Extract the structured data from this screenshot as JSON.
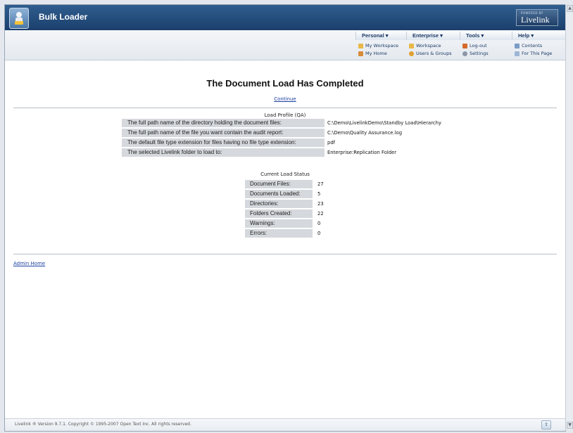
{
  "header": {
    "title": "Bulk Loader",
    "brand_small": "POWERED BY",
    "brand_name": "Livelink"
  },
  "nav": {
    "menus": [
      {
        "label": "Personal ▾",
        "links": [
          "My Workspace",
          "My Home"
        ]
      },
      {
        "label": "Enterprise ▾",
        "links": [
          "Workspace",
          "Users & Groups"
        ]
      },
      {
        "label": "Tools ▾",
        "links": [
          "Log-out",
          "Settings"
        ]
      },
      {
        "label": "Help ▾",
        "links": [
          "Contents",
          "For This Page"
        ]
      }
    ]
  },
  "page": {
    "title": "The Document Load Has Completed",
    "continue_link": "Continue",
    "profile_heading": "Load Profile (QA)",
    "profile_rows": [
      {
        "label": "The full path name of the directory holding the document files:",
        "value": "C:\\Demo\\LivelinkDemo\\Standby Load\\Hierarchy"
      },
      {
        "label": "The full path name of the file you want contain the audit report:",
        "value": "C:\\Demo\\Quality Assurance.log"
      },
      {
        "label": "The default file type extension for files having no file type extension:",
        "value": "pdf"
      },
      {
        "label": "The selected Livelink folder to load to:",
        "value": "Enterprise:Replication Folder"
      }
    ],
    "status_heading": "Current Load Status",
    "status_rows": [
      {
        "label": "Document Files:",
        "value": "27"
      },
      {
        "label": "Documents Loaded:",
        "value": "5"
      },
      {
        "label": "Directories:",
        "value": "23"
      },
      {
        "label": "Folders Created:",
        "value": "22"
      },
      {
        "label": "Warnings:",
        "value": "0"
      },
      {
        "label": "Errors:",
        "value": "0"
      }
    ],
    "admin_home_link": "Admin Home"
  },
  "footer": {
    "text": "Livelink ® Version 9.7.1. Copyright © 1995-2007 Open Text Inc. All rights reserved."
  },
  "colors": {
    "header_bg": "#1b3f6c",
    "link": "#1a3fa0",
    "label_bg": "#d5d8dc"
  }
}
